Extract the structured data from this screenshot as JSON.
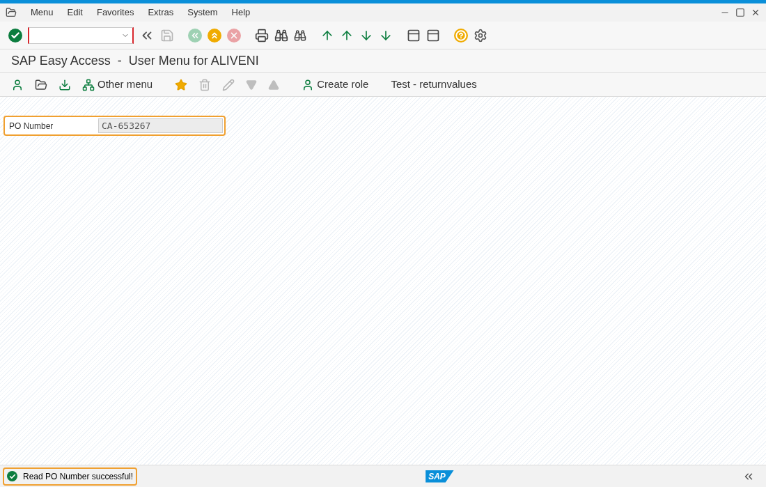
{
  "menu_bar": {
    "items": [
      "Menu",
      "Edit",
      "Favorites",
      "Extras",
      "System",
      "Help"
    ]
  },
  "system_toolbar": [
    {
      "kind": "enter",
      "disabled": false
    },
    {
      "kind": "collapse",
      "disabled": false
    },
    {
      "kind": "save",
      "disabled": true
    },
    {
      "kind": "back",
      "disabled": true
    },
    {
      "kind": "exit",
      "disabled": false
    },
    {
      "kind": "cancel",
      "disabled": true
    },
    {
      "kind": "print",
      "disabled": false
    },
    {
      "kind": "find",
      "disabled": false
    },
    {
      "kind": "find-next",
      "disabled": false
    },
    {
      "kind": "first-page",
      "disabled": false
    },
    {
      "kind": "prev-page",
      "disabled": false
    },
    {
      "kind": "next-page",
      "disabled": false
    },
    {
      "kind": "last-page",
      "disabled": false
    },
    {
      "kind": "new-session",
      "disabled": false
    },
    {
      "kind": "shortcut",
      "disabled": false
    },
    {
      "kind": "help",
      "disabled": false
    },
    {
      "kind": "settings",
      "disabled": false
    }
  ],
  "title": "SAP Easy Access  -  User Menu for ALIVENI",
  "app_toolbar": [
    {
      "kind": "user-menu",
      "disabled": false
    },
    {
      "kind": "sap-menu",
      "disabled": false
    },
    {
      "kind": "import",
      "disabled": false
    },
    {
      "kind": "tree",
      "label": "Other menu",
      "disabled": false
    },
    {
      "kind": "add-favorite",
      "disabled": false
    },
    {
      "kind": "delete-favorite",
      "disabled": true
    },
    {
      "kind": "edit",
      "disabled": true
    },
    {
      "kind": "down",
      "disabled": true
    },
    {
      "kind": "up",
      "disabled": true
    },
    {
      "kind": "user-menu",
      "label": "Create role",
      "disabled": false
    },
    {
      "kind": "text",
      "label": "Test - returnvalues",
      "disabled": false
    }
  ],
  "form": {
    "label": "PO Number",
    "value": "CA-653267",
    "highlighted": true
  },
  "status_bar": {
    "message": "Read PO Number successful!",
    "highlighted": true,
    "logo": "SAP"
  }
}
